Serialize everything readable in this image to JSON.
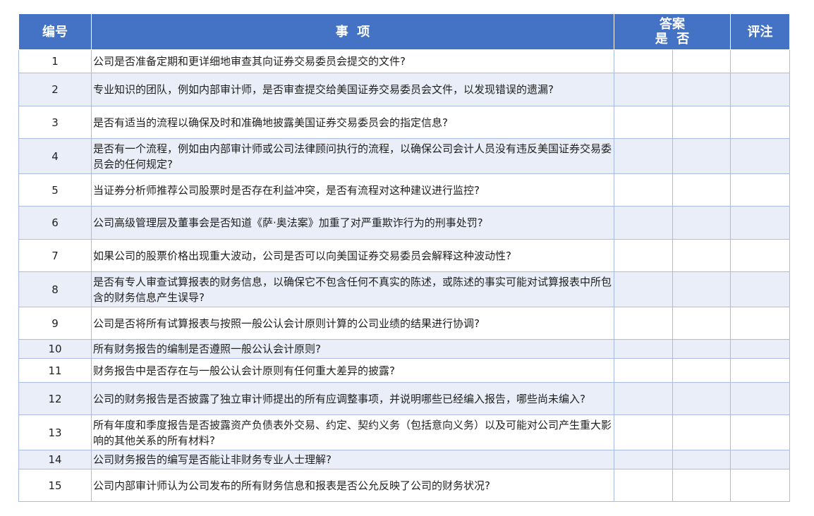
{
  "header": {
    "number": "编号",
    "item": "事  项",
    "answer": "答案",
    "yes_no": "是  否",
    "note": "评注"
  },
  "rows": [
    {
      "num": "1",
      "text": "公司是否准备定期和更详细地审查其向证券交易委员会提交的文件?"
    },
    {
      "num": "2",
      "text": "专业知识的团队，例如内部审计师，是否审查提交给美国证券交易委员会文件，以发现错误的遗漏?"
    },
    {
      "num": "3",
      "text": "是否有适当的流程以确保及时和准确地披露美国证券交易委员会的指定信息?"
    },
    {
      "num": "4",
      "text": "是否有一个流程，例如由内部审计师或公司法律顾问执行的流程，以确保公司会计人员没有违反美国证券交易委员会的任何规定?"
    },
    {
      "num": "5",
      "text": "当证券分析师推荐公司股票时是否存在利益冲突，是否有流程对这种建议进行监控?"
    },
    {
      "num": "6",
      "text": "公司高级管理层及董事会是否知道《萨·奥法案》加重了对严重欺诈行为的刑事处罚?"
    },
    {
      "num": "7",
      "text": "如果公司的股票价格出现重大波动，公司是否可以向美国证券交易委员会解释这种波动性?"
    },
    {
      "num": "8",
      "text": "是否有专人审查试算报表的财务信息，以确保它不包含任何不真实的陈述，或陈述的事实可能对试算报表中所包含的财务信息产生误导?"
    },
    {
      "num": "9",
      "text": "公司是否将所有试算报表与按照一般公认会计原则计算的公司业绩的结果进行协调?"
    },
    {
      "num": "10",
      "text": "所有财务报告的编制是否遵照一般公认会计原则?"
    },
    {
      "num": "11",
      "text": "财务报告中是否存在与一般公认会计原则有任何重大差异的披露?"
    },
    {
      "num": "12",
      "text": "公司的财务报告是否披露了独立审计师提出的所有应调整事项，并说明哪些已经编入报告，哪些尚未编入?"
    },
    {
      "num": "13",
      "text": "所有年度和季度报告是否披露资产负债表外交易、约定、契约义务（包括意向义务）以及可能对公司产生重大影响的其他关系的所有材料?"
    },
    {
      "num": "14",
      "text": "公司财务报告的编写是否能让非财务专业人士理解?"
    },
    {
      "num": "15",
      "text": "公司内部审计师认为公司发布的所有财务信息和报表是否公允反映了公司的财务状况?"
    }
  ],
  "colors": {
    "header_bg": "#4472C4",
    "header_text": "#FFFFFF",
    "alt_row_bg": "#E9EEF8",
    "border": "#A9BCE6"
  }
}
